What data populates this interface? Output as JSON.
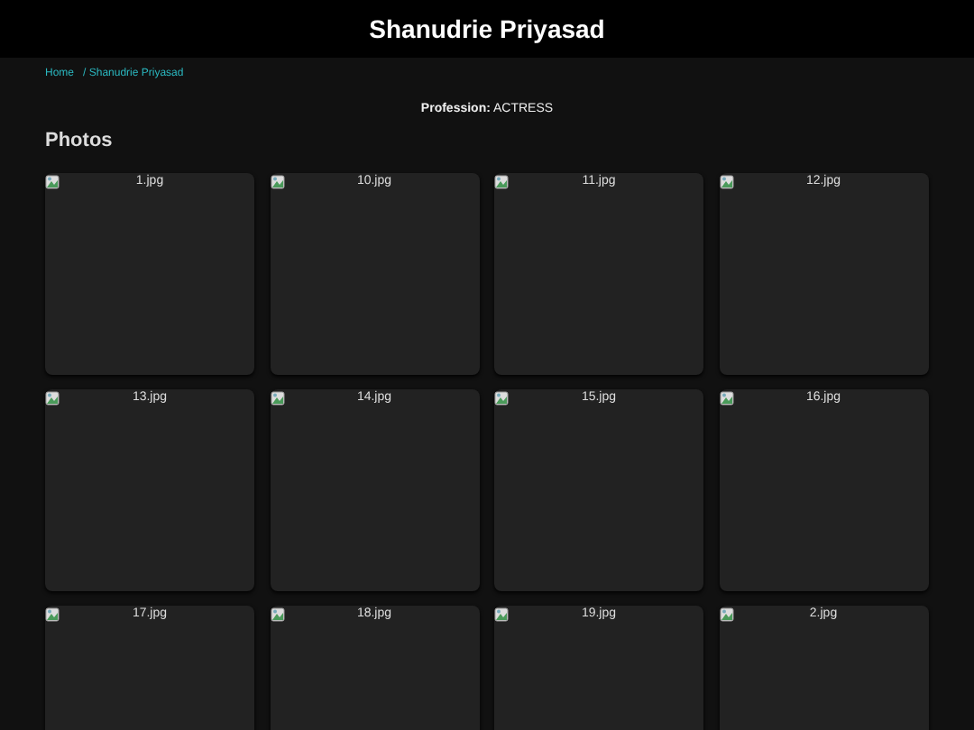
{
  "header": {
    "title": "Shanudrie Priyasad"
  },
  "breadcrumb": [
    {
      "label": "Home"
    },
    {
      "label": "/ Shanudrie Priyasad"
    }
  ],
  "profession": "**Profession:** ACTRESS",
  "section_title": "Photos",
  "photos": [
    {
      "caption": "1.jpg"
    },
    {
      "caption": "10.jpg"
    },
    {
      "caption": "11.jpg"
    },
    {
      "caption": "12.jpg"
    },
    {
      "caption": "13.jpg"
    },
    {
      "caption": "14.jpg"
    },
    {
      "caption": "15.jpg"
    },
    {
      "caption": "16.jpg"
    },
    {
      "caption": "17.jpg"
    },
    {
      "caption": "18.jpg"
    },
    {
      "caption": "19.jpg"
    },
    {
      "caption": "2.jpg"
    }
  ]
}
